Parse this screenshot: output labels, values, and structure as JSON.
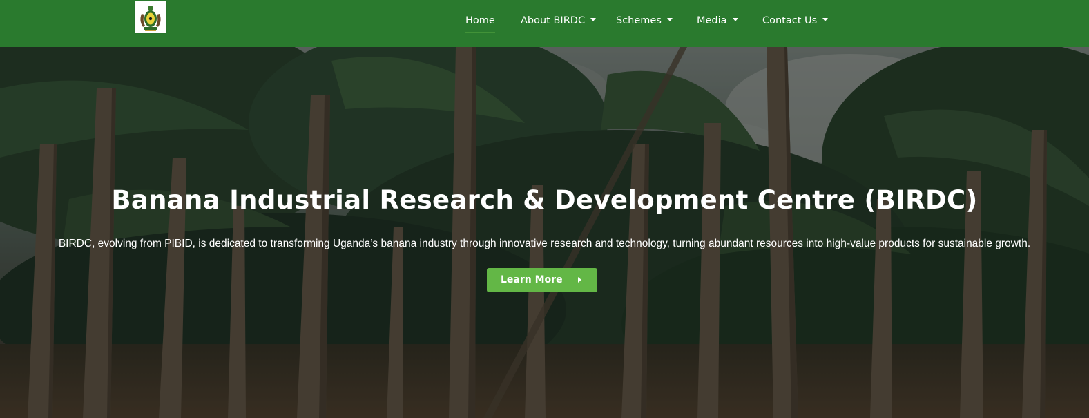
{
  "header": {
    "logo_icon": "uganda-coat-of-arms-icon",
    "nav": [
      {
        "label": "Home",
        "has_dropdown": false,
        "active": true
      },
      {
        "label": "About BIRDC",
        "has_dropdown": true
      },
      {
        "label": "Schemes",
        "has_dropdown": true
      },
      {
        "label": "Media",
        "has_dropdown": true
      },
      {
        "label": "Contact Us",
        "has_dropdown": true
      }
    ]
  },
  "hero": {
    "background": "banana-plantation-photo",
    "title": "Banana Industrial Research & Development Centre (BIRDC)",
    "description": "BIRDC, evolving from PIBID, is dedicated to transforming Uganda’s banana industry through innovative research and technology, turning abundant resources into high-value products for sustainable growth.",
    "button_label": "Learn More",
    "button_icon": "chevron-right-icon"
  },
  "colors": {
    "navbar_bg": "#2a7a2e",
    "button_bg": "#63b746",
    "text": "#ffffff"
  }
}
